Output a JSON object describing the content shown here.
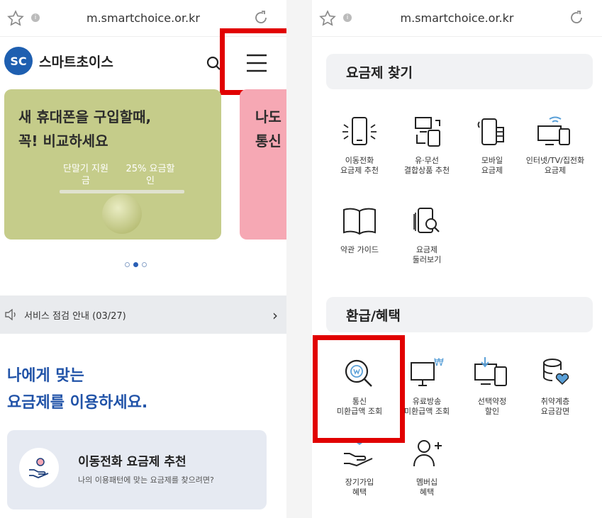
{
  "url": "m.smartchoice.or.kr",
  "colors": {
    "brand_blue": "#2153a8",
    "highlight_red": "#e10000",
    "banner_green": "#c5cc8a",
    "banner_pink": "#f6a8b4"
  },
  "left": {
    "logo_mark": "SC",
    "logo_text": "스마트초이스",
    "banner": {
      "title_line1": "새 휴대폰을 구입할때,",
      "title_line2": "꼭! 비교하세요",
      "label_left": "단말기 지원금",
      "label_right": "25% 요금할인"
    },
    "banner2": {
      "line1": "나도",
      "line2": "통신"
    },
    "notice": "서비스 점검 안내 (03/27)",
    "tagline_line1": "나에게 맞는",
    "tagline_line2": "요금제를 이용하세요.",
    "card": {
      "title": "이동전화 요금제 추천",
      "subtitle": "나의 이용패턴에 맞는 요금제를 찾으려면?"
    }
  },
  "right": {
    "section1_title": "요금제 찾기",
    "section1_items": [
      {
        "label": "이동전화\n요금제 추천",
        "icon": "phone-signal-icon"
      },
      {
        "label": "유·무선\n결합상품 추천",
        "icon": "devices-combo-icon"
      },
      {
        "label": "모바일\n요금제",
        "icon": "mobile-coin-icon"
      },
      {
        "label": "인터넷/TV/집전화\n요금제",
        "icon": "internet-tv-icon"
      },
      {
        "label": "약관 가이드",
        "icon": "book-icon"
      },
      {
        "label": "요금제\n둘러보기",
        "icon": "plan-search-icon"
      }
    ],
    "section2_title": "환급/혜택",
    "section2_items": [
      {
        "label": "통신\n미환급액 조회",
        "icon": "refund-search-icon"
      },
      {
        "label": "유료방송\n미환급액 조회",
        "icon": "pay-tv-refund-icon"
      },
      {
        "label": "선택약정\n할인",
        "icon": "contract-discount-icon"
      },
      {
        "label": "취약계층\n요금감면",
        "icon": "welfare-discount-icon"
      },
      {
        "label": "장기가입\n혜택",
        "icon": "long-term-benefit-icon"
      },
      {
        "label": "멤버십\n혜택",
        "icon": "membership-icon"
      }
    ]
  }
}
